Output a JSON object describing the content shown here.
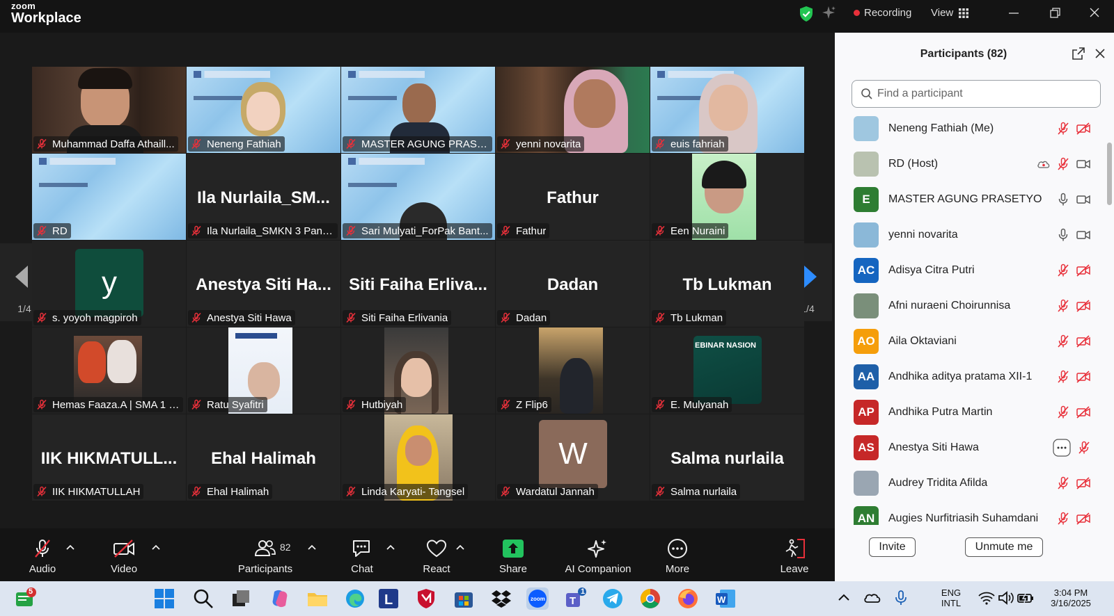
{
  "app": {
    "brand_small": "zoom",
    "brand_big": "Workplace"
  },
  "titlebar": {
    "recording_label": "Recording",
    "view_label": "View"
  },
  "tiles": [
    {
      "name": "Muhammad Daffa Athaill...",
      "kind": "camera"
    },
    {
      "name": "Neneng Fathiah",
      "kind": "banner-avatar"
    },
    {
      "name": "MASTER AGUNG PRASETYO",
      "kind": "banner-camera",
      "active": true
    },
    {
      "name": "yenni novarita",
      "kind": "camera"
    },
    {
      "name": "euis fahriah",
      "kind": "banner-camera"
    },
    {
      "name": "RD",
      "kind": "banner"
    },
    {
      "name": "Ila Nurlaila_SMKN 3 Pand...",
      "bigname": "Ila  Nurlaila_SM...",
      "kind": "text"
    },
    {
      "name": "Sari Mulyati_ForPak Bant...",
      "kind": "banner-camera"
    },
    {
      "name": "Fathur",
      "bigname": "Fathur",
      "kind": "text"
    },
    {
      "name": "Een Nuraini",
      "kind": "camera-small"
    },
    {
      "name": "s. yoyoh magpiroh",
      "letter": "y",
      "kind": "letter"
    },
    {
      "name": "Anestya Siti Hawa",
      "bigname": "Anestya  Siti  Ha...",
      "kind": "text"
    },
    {
      "name": "Siti Faiha Erlivania",
      "bigname": "Siti  Faiha  Erliva...",
      "kind": "text"
    },
    {
      "name": "Dadan",
      "bigname": "Dadan",
      "kind": "text"
    },
    {
      "name": "Tb Lukman",
      "bigname": "Tb Lukman",
      "kind": "text"
    },
    {
      "name": "Hemas Faaza.A | SMA 1 R...",
      "kind": "picture"
    },
    {
      "name": "Ratu Syafitri",
      "kind": "picture"
    },
    {
      "name": "Hutbiyah",
      "kind": "picture"
    },
    {
      "name": "Z Flip6",
      "kind": "picture"
    },
    {
      "name": "E. Mulyanah",
      "kind": "picture-webinar",
      "pic_text": "EBINAR NASION"
    },
    {
      "name": "IIK HIKMATULLAH",
      "bigname": "IIK  HIKMATULL...",
      "kind": "text"
    },
    {
      "name": "Ehal Halimah",
      "bigname": "Ehal Halimah",
      "kind": "text"
    },
    {
      "name": "Linda Karyati- Tangsel",
      "kind": "picture"
    },
    {
      "name": "Wardatul Jannah",
      "letter": "W",
      "kind": "letter"
    },
    {
      "name": "Salma nurlaila",
      "bigname": "Salma nurlaila",
      "kind": "text"
    }
  ],
  "pager": {
    "left_label": "1/4",
    "right_label": "1/4"
  },
  "toolbar": {
    "audio": "Audio",
    "video": "Video",
    "participants": "Participants",
    "participants_count": "82",
    "chat": "Chat",
    "react": "React",
    "share": "Share",
    "ai_companion": "AI Companion",
    "more": "More",
    "leave": "Leave"
  },
  "panel": {
    "title": "Participants (82)",
    "search_placeholder": "Find a participant",
    "participants": [
      {
        "name": "Neneng Fathiah (Me)",
        "initials": "",
        "color": "#9fc7e0",
        "mic": "muted",
        "video": "off"
      },
      {
        "name": "RD (Host)",
        "initials": "",
        "color": "#b9c2b0",
        "mic": "muted",
        "video": "on",
        "cloud": true
      },
      {
        "name": "MASTER AGUNG PRASETYO",
        "initials": "E",
        "color": "#2e7d32",
        "mic": "on",
        "video": "on"
      },
      {
        "name": "yenni novarita",
        "initials": "",
        "color": "#8bb8d8",
        "mic": "on",
        "video": "on"
      },
      {
        "name": "Adisya Citra Putri",
        "initials": "AC",
        "color": "#1565c0",
        "mic": "muted",
        "video": "off"
      },
      {
        "name": "Afni nuraeni Choirunnisa",
        "initials": "",
        "color": "#7a8f7a",
        "mic": "muted",
        "video": "off"
      },
      {
        "name": "Aila Oktaviani",
        "initials": "AO",
        "color": "#f59e0b",
        "mic": "muted",
        "video": "off"
      },
      {
        "name": "Andhika aditya pratama XII-1",
        "initials": "AA",
        "color": "#1e5fa8",
        "mic": "muted",
        "video": "off"
      },
      {
        "name": "Andhika Putra Martin",
        "initials": "AP",
        "color": "#c62828",
        "mic": "muted",
        "video": "off"
      },
      {
        "name": "Anestya Siti Hawa",
        "initials": "AS",
        "color": "#c62828",
        "mic": "muted",
        "video": "more"
      },
      {
        "name": "Audrey Tridita Afilda",
        "initials": "",
        "color": "#9aa6b2",
        "mic": "muted",
        "video": "off"
      },
      {
        "name": "Augies Nurfitriasih Suhamdani",
        "initials": "AN",
        "color": "#2e7d32",
        "mic": "muted",
        "video": "off"
      }
    ],
    "invite_label": "Invite",
    "unmute_label": "Unmute me"
  },
  "taskbar": {
    "whatsapp_badge": "5",
    "teams_badge": "1",
    "lang_line1": "ENG",
    "lang_line2": "INTL",
    "time": "3:04 PM",
    "date": "3/16/2025"
  }
}
